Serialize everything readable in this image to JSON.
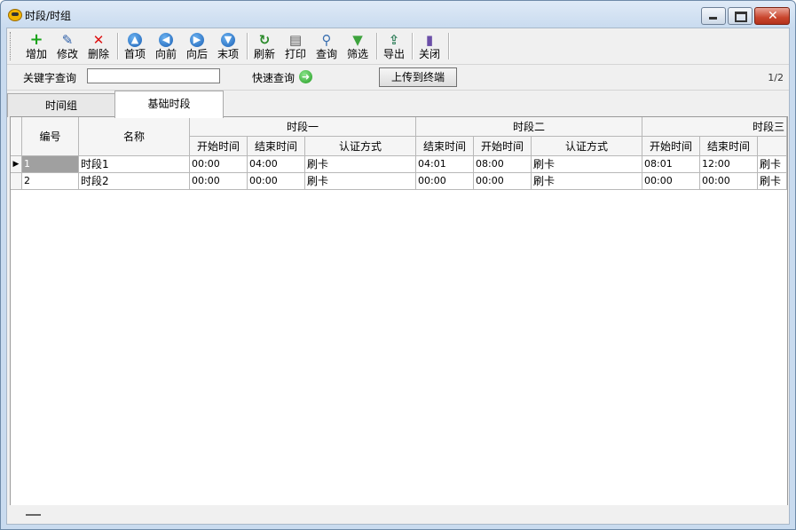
{
  "window": {
    "title": "时段/时组"
  },
  "toolbar": [
    {
      "label": "增加",
      "icon": "add-icon"
    },
    {
      "label": "修改",
      "icon": "edit-icon"
    },
    {
      "label": "删除",
      "icon": "delete-icon"
    },
    {
      "label": "首项",
      "icon": "first-icon"
    },
    {
      "label": "向前",
      "icon": "previous-icon"
    },
    {
      "label": "向后",
      "icon": "next-icon"
    },
    {
      "label": "末项",
      "icon": "last-icon"
    },
    {
      "label": "刷新",
      "icon": "refresh-icon"
    },
    {
      "label": "打印",
      "icon": "print-icon"
    },
    {
      "label": "查询",
      "icon": "search-icon"
    },
    {
      "label": "筛选",
      "icon": "filter-icon"
    },
    {
      "label": "导出",
      "icon": "export-icon"
    },
    {
      "label": "关闭",
      "icon": "close-door-icon"
    }
  ],
  "query": {
    "label": "关键字查询",
    "value": "",
    "quick": "快速查询",
    "upload": "上传到终端",
    "pages": "1/2"
  },
  "tabs": [
    "时间组",
    "基础时段"
  ],
  "table": {
    "col_no": "编号",
    "col_name": "名称",
    "groups": [
      "时段一",
      "时段二",
      "时段三"
    ],
    "sub": {
      "g1": [
        "开始时间",
        "结束时间",
        "认证方式"
      ],
      "g2": [
        "结束时间",
        "开始时间",
        "认证方式"
      ],
      "g3": [
        "开始时间",
        "结束时间"
      ]
    },
    "rows": [
      {
        "no": "1",
        "name": "时段1",
        "c": [
          "00:00",
          "04:00",
          "刷卡",
          "04:01",
          "08:00",
          "刷卡",
          "08:01",
          "12:00",
          "刷卡"
        ]
      },
      {
        "no": "2",
        "name": "时段2",
        "c": [
          "00:00",
          "00:00",
          "刷卡",
          "00:00",
          "00:00",
          "刷卡",
          "00:00",
          "00:00",
          "刷卡"
        ]
      }
    ]
  },
  "colors": {
    "titlebar": "#c9dbef",
    "close": "#c9462d",
    "selected_cell": "#a0a0a0"
  }
}
